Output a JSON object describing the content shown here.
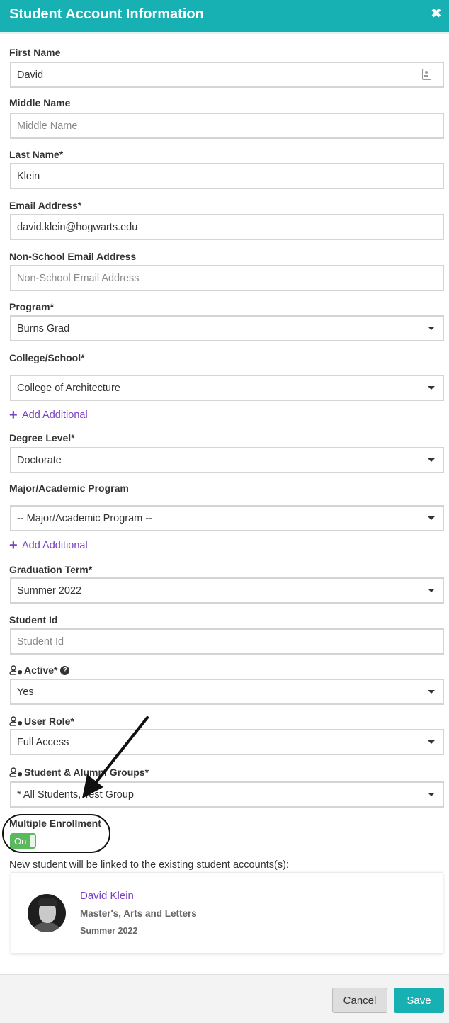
{
  "header": {
    "title": "Student Account Information",
    "close_glyph": "✖"
  },
  "form": {
    "first_name": {
      "label": "First Name",
      "value": "David"
    },
    "middle_name": {
      "label": "Middle Name",
      "placeholder": "Middle Name"
    },
    "last_name": {
      "label": "Last Name*",
      "value": "Klein"
    },
    "email": {
      "label": "Email Address*",
      "value": "david.klein@hogwarts.edu"
    },
    "non_school_email": {
      "label": "Non-School Email Address",
      "placeholder": "Non-School Email Address"
    },
    "program": {
      "label": "Program*",
      "value": "Burns Grad"
    },
    "college": {
      "label": "College/School*",
      "value": "College of Architecture"
    },
    "add_additional_1": "Add Additional",
    "degree_level": {
      "label": "Degree Level*",
      "value": "Doctorate"
    },
    "major": {
      "label": "Major/Academic Program",
      "value": "-- Major/Academic Program --"
    },
    "add_additional_2": "Add Additional",
    "graduation_term": {
      "label": "Graduation Term*",
      "value": "Summer 2022"
    },
    "student_id": {
      "label": "Student Id",
      "placeholder": "Student Id"
    },
    "active": {
      "label": "Active*",
      "value": "Yes",
      "help_glyph": "?"
    },
    "user_role": {
      "label": "User Role*",
      "value": "Full Access"
    },
    "groups": {
      "label": "Student & Alumni Groups*",
      "value": "* All Students, Test Group"
    },
    "multiple_enrollment": {
      "label": "Multiple Enrollment",
      "toggle_label": "On",
      "enabled": true
    },
    "linked_notice": "New student will be linked to the existing student accounts(s):"
  },
  "linked_account": {
    "name": "David Klein",
    "program": "Master's, Arts and Letters",
    "term": "Summer 2022"
  },
  "footer": {
    "cancel_label": "Cancel",
    "save_label": "Save"
  },
  "colors": {
    "header": "#17b0b3",
    "link": "#7b3fc4",
    "toggle_on": "#5cb85c",
    "save_button": "#17b0b3"
  },
  "icons": [
    "close-icon",
    "contact-card-icon",
    "caret-down-icon",
    "plus-icon",
    "user-shield-icon",
    "help-icon"
  ]
}
